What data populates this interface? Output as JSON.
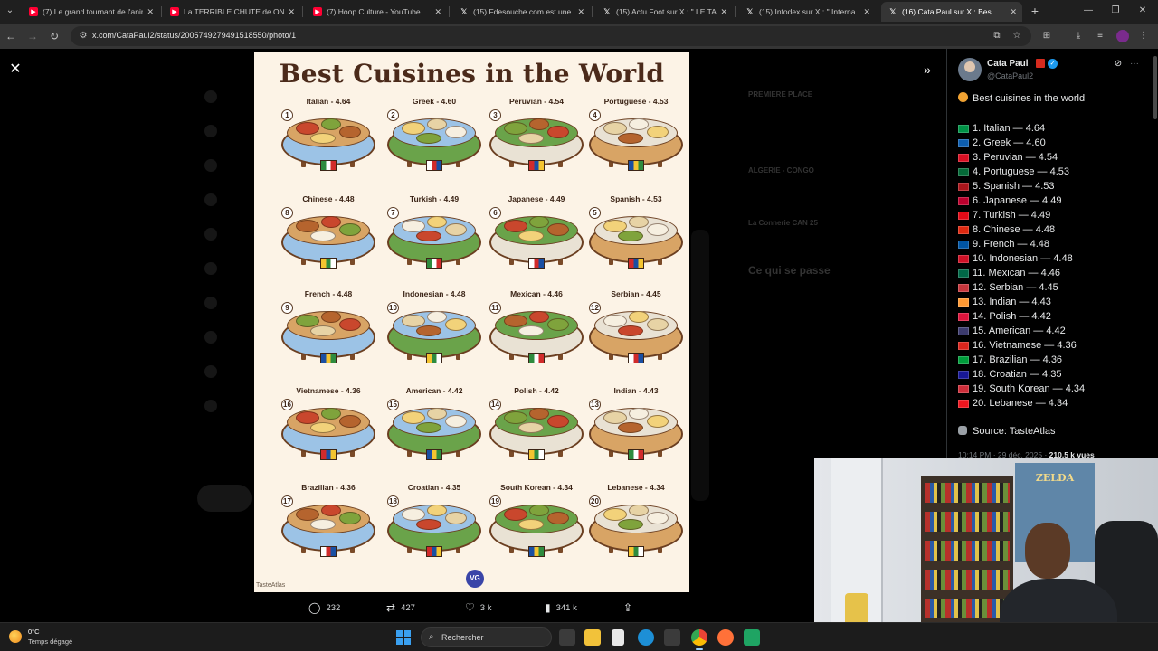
{
  "browser": {
    "tabs": [
      {
        "title": "(7) Le grand tournant de l'anim",
        "kind": "youtube"
      },
      {
        "title": "La TERRIBLE CHUTE de ONE PL",
        "kind": "youtube"
      },
      {
        "title": "(7) Hoop Culture - YouTube",
        "kind": "youtube"
      },
      {
        "title": "(15) Fdesouche.com est une re",
        "kind": "x"
      },
      {
        "title": "(15) Actu Foot sur X : \" LE TA",
        "kind": "x"
      },
      {
        "title": "(15) Infodex sur X : \" Interna",
        "kind": "x"
      },
      {
        "title": "(16) Cata Paul sur X : Bes",
        "kind": "x",
        "active": true
      }
    ],
    "url": "x.com/CataPaul2/status/2005749279491518550/photo/1"
  },
  "background_ghost": {
    "trend_1": "PREMIERE PLACE",
    "trend_2": "ALGERIE - CONGO",
    "trend_3": "La Connerie CAN 25",
    "section": "Ce qui se passe"
  },
  "infographic": {
    "title": "Best Cuisines in the World",
    "watermark": "TasteAtlas",
    "badge": "VG",
    "dishes": [
      {
        "n": "1",
        "label": "Italian - 4.64"
      },
      {
        "n": "2",
        "label": "Greek - 4.60"
      },
      {
        "n": "3",
        "label": "Peruvian - 4.54"
      },
      {
        "n": "4",
        "label": "Portuguese - 4.53"
      },
      {
        "n": "8",
        "label": "Chinese - 4.48"
      },
      {
        "n": "7",
        "label": "Turkish - 4.49"
      },
      {
        "n": "6",
        "label": "Japanese - 4.49"
      },
      {
        "n": "5",
        "label": "Spanish - 4.53"
      },
      {
        "n": "9",
        "label": "French - 4.48"
      },
      {
        "n": "10",
        "label": "Indonesian - 4.48"
      },
      {
        "n": "11",
        "label": "Mexican - 4.46"
      },
      {
        "n": "12",
        "label": "Serbian - 4.45"
      },
      {
        "n": "16",
        "label": "Vietnamese - 4.36"
      },
      {
        "n": "15",
        "label": "American - 4.42"
      },
      {
        "n": "14",
        "label": "Polish - 4.42"
      },
      {
        "n": "13",
        "label": "Indian - 4.43"
      },
      {
        "n": "17",
        "label": "Brazilian - 4.36"
      },
      {
        "n": "18",
        "label": "Croatian - 4.35"
      },
      {
        "n": "19",
        "label": "South Korean - 4.34"
      },
      {
        "n": "20",
        "label": "Lebanese - 4.34"
      }
    ]
  },
  "actions": {
    "replies": "232",
    "reposts": "427",
    "likes": "3 k",
    "views": "341 k"
  },
  "tweet": {
    "author_name": "Cata Paul",
    "author_handle": "@CataPaul2",
    "heading": "Best cuisines in the world",
    "rankings": [
      "1. Italian — 4.64",
      "2. Greek — 4.60",
      "3. Peruvian — 4.54",
      "4. Portuguese — 4.53",
      "5. Spanish — 4.53",
      "6. Japanese — 4.49",
      "7. Turkish — 4.49",
      "8. Chinese — 4.48",
      "9. French — 4.48",
      "10. Indonesian — 4.48",
      "11. Mexican — 4.46",
      "12. Serbian — 4.45",
      "13. Indian — 4.43",
      "14. Polish — 4.42",
      "15. American — 4.42",
      "16. Vietnamese — 4.36",
      "17. Brazilian — 4.36",
      "18. Croatian — 4.35",
      "19. South Korean — 4.34",
      "20. Lebanese — 4.34"
    ],
    "source": "Source: TasteAtlas",
    "time": "10:14 PM · 29 déc. 2025 · ",
    "views": "210,5 k vues"
  },
  "webcam": {
    "poster_text": "ZELDA"
  },
  "taskbar": {
    "temperature": "0°C",
    "weather": "Temps dégagé",
    "search_placeholder": "Rechercher"
  }
}
